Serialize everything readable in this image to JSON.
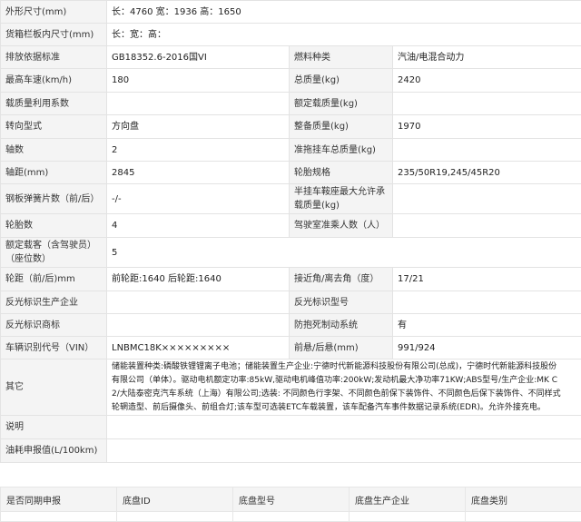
{
  "rows": [
    {
      "l1": "外形尺寸(mm)",
      "v1": "长：4760 宽：1936 高：1650"
    },
    {
      "l1": "货箱栏板内尺寸(mm)",
      "v1": "长：宽：高："
    },
    {
      "l1": "排放依据标准",
      "v1": "GB18352.6-2016国VI",
      "l2": "燃料种类",
      "v2": "汽油/电混合动力"
    },
    {
      "l1": "最高车速(km/h)",
      "v1": "180",
      "l2": "总质量(kg)",
      "v2": "2420"
    },
    {
      "l1": "载质量利用系数",
      "v1": "",
      "l2": "额定载质量(kg)",
      "v2": ""
    },
    {
      "l1": "转向型式",
      "v1": "方向盘",
      "l2": "整备质量(kg)",
      "v2": "1970"
    },
    {
      "l1": "轴数",
      "v1": "2",
      "l2": "准拖挂车总质量(kg)",
      "v2": ""
    },
    {
      "l1": "轴距(mm)",
      "v1": "2845",
      "l2": "轮胎规格",
      "v2": "235/50R19,245/45R20"
    },
    {
      "l1": "钢板弹簧片数（前/后）",
      "v1": "-/-",
      "l2": "半挂车鞍座最大允许承载质量(kg)",
      "v2": ""
    },
    {
      "l1": "轮胎数",
      "v1": "4",
      "l2": "驾驶室准乘人数（人）",
      "v2": ""
    },
    {
      "l1": "额定载客（含驾驶员）（座位数）",
      "v1": "5"
    },
    {
      "l1": "轮距（前/后)mm",
      "v1": "前轮距:1640 后轮距:1640",
      "l2": "接近角/离去角（度）",
      "v2": "17/21"
    },
    {
      "l1": "反光标识生产企业",
      "v1": "",
      "l2": "反光标识型号",
      "v2": ""
    },
    {
      "l1": "反光标识商标",
      "v1": "",
      "l2": "防抱死制动系统",
      "v2": "有"
    },
    {
      "l1": "车辆识别代号（VIN）",
      "v1": "LNBMC18K×××××××××",
      "l2": "前悬/后悬(mm)",
      "v2": "991/924"
    }
  ],
  "other": {
    "label": "其它",
    "lines": [
      "储能装置种类:磷酸铁锂锂离子电池；储能装置生产企业:宁德时代新能源科技股份有限公司(总成)，宁德时代新能源科技股份",
      "有限公司（单体）。驱动电机额定功率:85kW,驱动电机峰值功率:200kW;发动机最大净功率71KW;ABS型号/生产企业:MK C",
      "2/大陆泰密克汽车系统（上海）有限公司;选装: 不同颜色行李架、不同颜色前保下装饰件、不同颜色后保下装饰件、不同样式",
      "轮辋造型、前后摄像头、前组合灯;该车型可选装ETC车载装置，该车配备汽车事件数据记录系统(EDR)。允许外接充电。"
    ]
  },
  "explain": {
    "label": "说明",
    "value": ""
  },
  "fuel": {
    "label": "油耗申报值(L/100km)",
    "value": ""
  },
  "chassis": {
    "headers": [
      "是否同期申报",
      "底盘ID",
      "底盘型号",
      "底盘生产企业",
      "底盘类别"
    ]
  }
}
